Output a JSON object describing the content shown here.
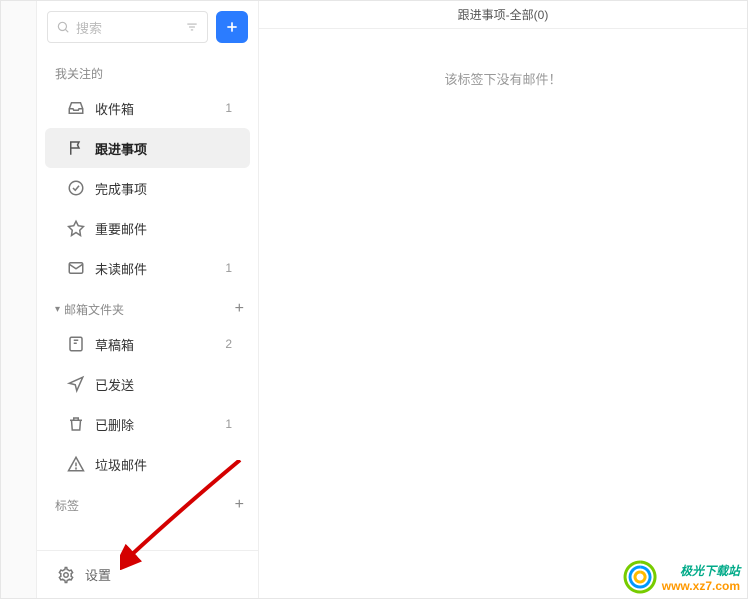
{
  "search": {
    "placeholder": "搜索"
  },
  "sections": {
    "following": "我关注的",
    "folders": "邮箱文件夹",
    "tags": "标签"
  },
  "nav": {
    "inbox": {
      "label": "收件箱",
      "count": "1"
    },
    "followup": {
      "label": "跟进事项",
      "count": ""
    },
    "done": {
      "label": "完成事项",
      "count": ""
    },
    "important": {
      "label": "重要邮件",
      "count": ""
    },
    "unread": {
      "label": "未读邮件",
      "count": "1"
    },
    "drafts": {
      "label": "草稿箱",
      "count": "2"
    },
    "sent": {
      "label": "已发送",
      "count": ""
    },
    "deleted": {
      "label": "已删除",
      "count": "1"
    },
    "spam": {
      "label": "垃圾邮件",
      "count": ""
    }
  },
  "settings": {
    "label": "设置"
  },
  "main": {
    "title": "跟进事项-全部(0)",
    "empty": "该标签下没有邮件！"
  },
  "watermark": {
    "line1": "极光下载站",
    "line2": "www.xz7.com"
  }
}
